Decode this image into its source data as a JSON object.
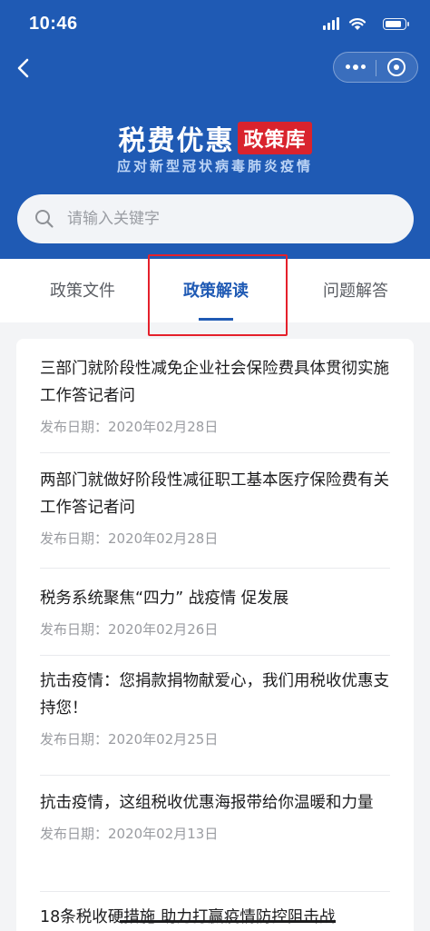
{
  "status_bar": {
    "time": "10:46"
  },
  "header": {
    "title_main": "税费优惠",
    "title_badge": "政策库",
    "subtitle": "应对新型冠状病毒肺炎疫情",
    "brand_color": "#1f5ab4",
    "badge_color": "#d9232d"
  },
  "search": {
    "placeholder": "请输入关键字",
    "value": ""
  },
  "tabs": [
    {
      "label": "政策文件",
      "active": false
    },
    {
      "label": "政策解读",
      "active": true
    },
    {
      "label": "问题解答",
      "active": false
    }
  ],
  "articles": [
    {
      "title": "三部门就阶段性减免企业社会保险费具体贯彻实施工作答记者问",
      "date": "发布日期：2020年02月28日"
    },
    {
      "title": "两部门就做好阶段性减征职工基本医疗保险费有关工作答记者问",
      "date": "发布日期：2020年02月28日"
    },
    {
      "title": "税务系统聚焦“四力” 战疫情 促发展",
      "date": "发布日期：2020年02月26日"
    },
    {
      "title": "抗击疫情：您捐款捐物献爱心，我们用税收优惠支持您！",
      "date": "发布日期：2020年02月25日"
    },
    {
      "title": "抗击疫情，这组税收优惠海报带给你温暖和力量",
      "date": "发布日期：2020年02月13日"
    },
    {
      "title": "18条税收硬措施 助力打赢疫情防控阻击战",
      "date": ""
    }
  ],
  "icons": {
    "back": "chevron-left-icon",
    "more": "more-dots-icon",
    "close": "mini-program-close-icon",
    "search": "search-icon"
  }
}
